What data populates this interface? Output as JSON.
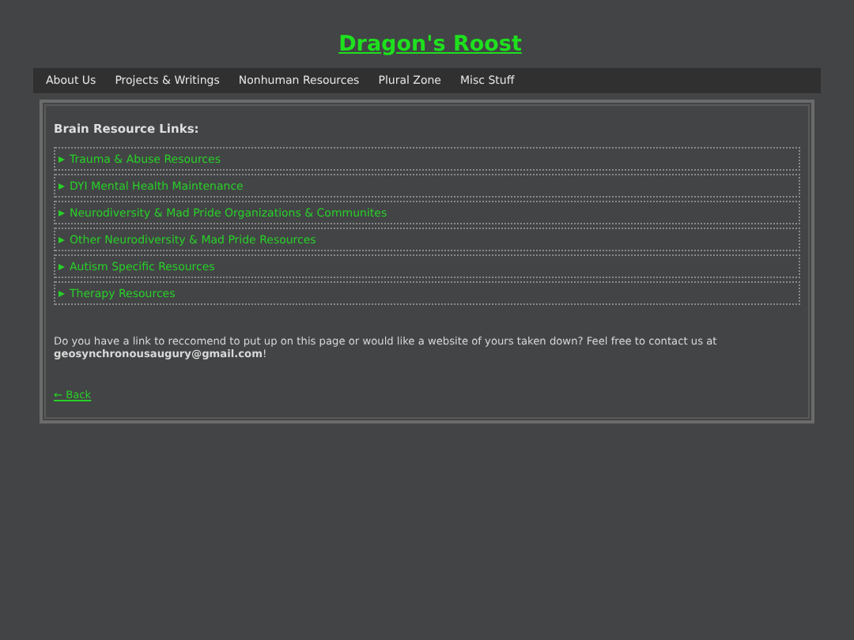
{
  "site_title": "Dragon's Roost",
  "nav": [
    {
      "label": "About Us"
    },
    {
      "label": "Projects & Writings"
    },
    {
      "label": "Nonhuman Resources"
    },
    {
      "label": "Plural Zone"
    },
    {
      "label": "Misc Stuff"
    }
  ],
  "heading": "Brain Resource Links:",
  "sections": [
    {
      "label": "Trauma & Abuse Resources",
      "expanded": false
    },
    {
      "label": "DYI Mental Health Maintenance",
      "expanded": false
    },
    {
      "label": "Neurodiversity & Mad Pride Organizations & Communites",
      "expanded": false
    },
    {
      "label": "Other Neurodiversity & Mad Pride Resources",
      "expanded": false
    },
    {
      "label": "Autism Specific Resources",
      "expanded": false
    },
    {
      "label": "Therapy Resources",
      "expanded": false
    }
  ],
  "contact_text": "Do you have a link to reccomend to put up on this page or would like a website of yours taken down? Feel free to contact us at **geosynchronousaugury@gmail.com**!",
  "back_link": "← Back"
}
